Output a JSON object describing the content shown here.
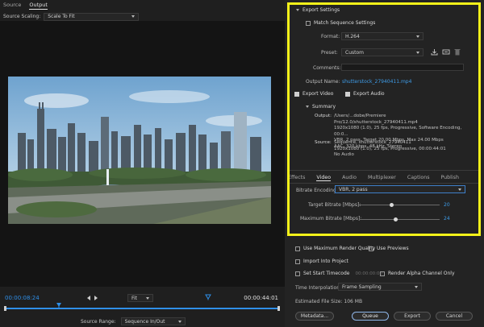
{
  "monitor": {
    "tabs": [
      "Source",
      "Output"
    ],
    "source_scaling_label": "Source Scaling:",
    "source_scaling_value": "Scale To Fit",
    "timecode_start": "00:00:08:24",
    "timecode_end": "00:00:44:01",
    "zoom_value": "Fit",
    "source_range_label": "Source Range:",
    "source_range_value": "Sequence In/Out"
  },
  "export_settings": {
    "header": "Export Settings",
    "match_sequence": "Match Sequence Settings",
    "format_label": "Format:",
    "format_value": "H.264",
    "preset_label": "Preset:",
    "preset_value": "Custom",
    "comments_label": "Comments:",
    "comments_value": "",
    "output_name_label": "Output Name:",
    "output_name_value": "shutterstock_27940411.mp4",
    "export_video": "Export Video",
    "export_audio": "Export Audio",
    "summary_header": "Summary",
    "output_label": "Output:",
    "output_lines": [
      "/Users/...dobe/Premiere Pro/12.0/shutterstock_27940411.mp4",
      "1920x1080 (1.0), 25 fps, Progressive, Software Encoding, 00:0...",
      "VBR, 2 pass, Target 20.00 Mbps, Max 24.00 Mbps",
      "AAC, 320 kbps, 48 kHz, Stereo"
    ],
    "source_label": "Source:",
    "source_lines": [
      "Sequence, shutterstock_27940411",
      "1920x1080 (1.0), 25 fps, Progressive, 00:00:44:01",
      "No Audio"
    ]
  },
  "subtabs": [
    "Effects",
    "Video",
    "Audio",
    "Multiplexer",
    "Captions",
    "Publish"
  ],
  "bitrate": {
    "encoding_label": "Bitrate Encoding:",
    "encoding_value": "VBR, 2 pass",
    "target_label": "Target Bitrate [Mbps]:",
    "target_value": "20",
    "target_level": 0.4,
    "max_label": "Maximum Bitrate [Mbps]:",
    "max_value": "24",
    "max_level": 0.45
  },
  "bottom": {
    "max_render_quality": "Use Maximum Render Quality",
    "use_previews": "Use Previews",
    "import_into_project": "Import Into Project",
    "set_start_timecode": "Set Start Timecode",
    "start_timecode_value": "00:00:00:00",
    "render_alpha": "Render Alpha Channel Only",
    "time_interp_label": "Time Interpolation:",
    "time_interp_value": "Frame Sampling",
    "file_size": "Estimated File Size: 106 MB",
    "metadata_btn": "Metadata...",
    "queue_btn": "Queue",
    "export_btn": "Export",
    "cancel_btn": "Cancel"
  },
  "colors": {
    "accent_blue": "#2f8fe8",
    "highlight_yellow": "#f5f21a"
  }
}
